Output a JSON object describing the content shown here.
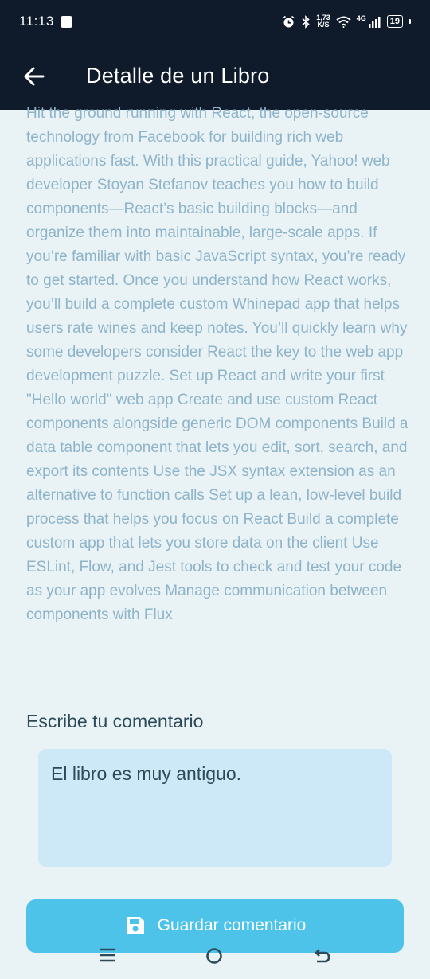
{
  "status_bar": {
    "time": "11:13",
    "net_speed_value": "1,73",
    "net_speed_unit": "K/S",
    "network_type": "4G",
    "battery_level": "19"
  },
  "app_bar": {
    "title": "Detalle de un Libro"
  },
  "book": {
    "description": "Hit the ground running with React, the open-source technology from Facebook for building rich web applications fast. With this practical guide, Yahoo! web developer Stoyan Stefanov teaches you how to build components—React’s basic building blocks—and organize them into maintainable, large-scale apps. If you’re familiar with basic JavaScript syntax, you’re ready to get started. Once you understand how React works, you’ll build a complete custom Whinepad app that helps users rate wines and keep notes. You’ll quickly learn why some developers consider React the key to the web app development puzzle. Set up React and write your first \"Hello world\" web app Create and use custom React components alongside generic DOM components Build a data table component that lets you edit, sort, search, and export its contents Use the JSX syntax extension as an alternative to function calls Set up a lean, low-level build process that helps you focus on React Build a complete custom app that lets you store data on the client Use ESLint, Flow, and Jest tools to check and test your code as your app evolves Manage communication between components with Flux"
  },
  "comment": {
    "label": "Escribe tu comentario",
    "value": "El libro es muy antiguo."
  },
  "save_button": {
    "label": "Guardar comentario"
  },
  "colors": {
    "app_bar": "#0f1a2b",
    "background": "#e9f3f6",
    "accent": "#4ec3ea",
    "input_background": "#cde9f8",
    "description_text": "#8fb3c9"
  }
}
